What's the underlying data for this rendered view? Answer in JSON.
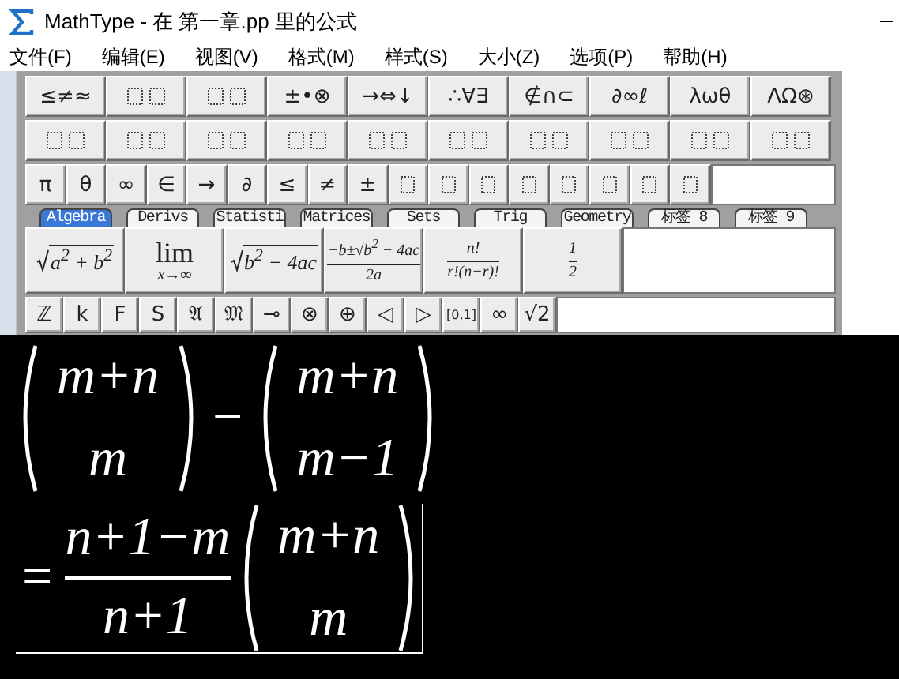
{
  "window": {
    "title": "MathType - 在 第一章.pp 里的公式"
  },
  "menu": [
    "文件(F)",
    "编辑(E)",
    "视图(V)",
    "格式(M)",
    "样式(S)",
    "大小(Z)",
    "选项(P)",
    "帮助(H)"
  ],
  "palette": {
    "rows": [
      [
        {
          "kind": "symbol",
          "label": "≤≠≈"
        },
        {
          "kind": "template"
        },
        {
          "kind": "template"
        },
        {
          "kind": "symbol",
          "label": "±•⊗"
        },
        {
          "kind": "symbol",
          "label": "→⇔↓"
        },
        {
          "kind": "symbol",
          "label": "∴∀∃"
        },
        {
          "kind": "symbol",
          "label": "∉∩⊂"
        },
        {
          "kind": "symbol",
          "label": "∂∞ℓ"
        },
        {
          "kind": "symbol",
          "label": "λωθ"
        },
        {
          "kind": "symbol",
          "label": "ΛΩ⊛"
        }
      ],
      [
        {
          "kind": "template"
        },
        {
          "kind": "template"
        },
        {
          "kind": "template"
        },
        {
          "kind": "template"
        },
        {
          "kind": "template"
        },
        {
          "kind": "template"
        },
        {
          "kind": "template"
        },
        {
          "kind": "template"
        },
        {
          "kind": "template"
        },
        {
          "kind": "template"
        }
      ]
    ],
    "small_bar": [
      {
        "kind": "symbol",
        "label": "π"
      },
      {
        "kind": "symbol",
        "label": "θ"
      },
      {
        "kind": "symbol",
        "label": "∞"
      },
      {
        "kind": "symbol",
        "label": "∈"
      },
      {
        "kind": "symbol",
        "label": "→"
      },
      {
        "kind": "symbol",
        "label": "∂"
      },
      {
        "kind": "symbol",
        "label": "≤"
      },
      {
        "kind": "symbol",
        "label": "≠"
      },
      {
        "kind": "symbol",
        "label": "±"
      },
      {
        "kind": "template"
      },
      {
        "kind": "template"
      },
      {
        "kind": "template"
      },
      {
        "kind": "template"
      },
      {
        "kind": "template"
      },
      {
        "kind": "template"
      },
      {
        "kind": "template"
      },
      {
        "kind": "template"
      }
    ],
    "tabs": [
      {
        "label": "Algebra",
        "selected": true
      },
      {
        "label": "Derivs",
        "selected": false
      },
      {
        "label": "Statisti",
        "selected": false
      },
      {
        "label": "Matrices",
        "selected": false
      },
      {
        "label": "Sets",
        "selected": false
      },
      {
        "label": "Trig",
        "selected": false
      },
      {
        "label": "Geometry",
        "selected": false
      },
      {
        "label": "标签 8",
        "selected": false
      },
      {
        "label": "标签 9",
        "selected": false
      }
    ],
    "expressions": [
      {
        "kind": "sqrt",
        "body": "a$^{2}$ + b$^{2}$"
      },
      {
        "kind": "limit",
        "top": "lim",
        "bottom": "x→∞"
      },
      {
        "kind": "sqrt",
        "body": "b$^{2}$ − 4ac"
      },
      {
        "kind": "fraction",
        "numerator": "−b±√b$^{2}$ − 4ac",
        "denominator": "2a"
      },
      {
        "kind": "fraction",
        "numerator": "n!",
        "denominator": "r!(n−r)!"
      },
      {
        "kind": "fraction",
        "numerator": "1",
        "denominator": "2"
      }
    ],
    "small_symbols": [
      "ℤ",
      "k",
      "F",
      "S",
      "𝔄",
      "𝔐",
      "⊸",
      "⊗",
      "⊕",
      "◁",
      "▷",
      "[0,1]",
      "∞",
      "√2"
    ]
  },
  "equation": {
    "lines": [
      {
        "selected": false,
        "items": [
          {
            "kind": "binom",
            "top": "m+n",
            "bottom": "m"
          },
          {
            "kind": "operator",
            "text": "−"
          },
          {
            "kind": "binom",
            "top": "m+n",
            "bottom": "m−1"
          }
        ]
      },
      {
        "selected": true,
        "items": [
          {
            "kind": "operator",
            "text": "="
          },
          {
            "kind": "fraction",
            "numerator": "n+1−m",
            "denominator": "n+1"
          },
          {
            "kind": "binom",
            "top": "m+n",
            "bottom": "m"
          }
        ]
      }
    ]
  }
}
